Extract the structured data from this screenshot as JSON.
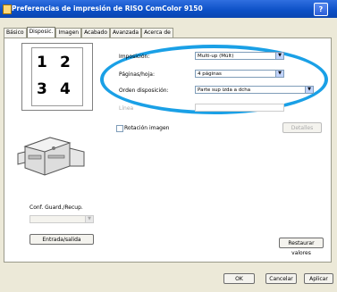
{
  "window": {
    "title": "Preferencias de impresión de RISO ComColor 9150",
    "help_label": "?"
  },
  "tabs": [
    {
      "label": "Básico"
    },
    {
      "label": "Disposic."
    },
    {
      "label": "Imagen"
    },
    {
      "label": "Acabado"
    },
    {
      "label": "Avanzada"
    },
    {
      "label": "Acerca de"
    }
  ],
  "preview": {
    "numbers": [
      "1",
      "2",
      "3",
      "4"
    ]
  },
  "layout": {
    "imposition_label": "Imposición:",
    "imposition_value": "Multi-up (Múlt)",
    "pages_label": "Páginas/hoja:",
    "pages_value": "4 páginas",
    "order_label": "Orden disposición:",
    "order_value": "Parte sup izda a dcha",
    "line_label": "Línea",
    "line_value": ""
  },
  "rotate": {
    "label": "Rotación imagen",
    "button_label": "Detalles"
  },
  "config": {
    "label": "Conf. Guard./Recup.",
    "input_value": "",
    "button_label": "Entrada/salida"
  },
  "restore_label": "Restaurar valores",
  "footer": {
    "ok_label": "OK",
    "cancel_label": "Cancelar",
    "apply_label": "Aplicar"
  },
  "highlight_color": "#1aa0e6"
}
